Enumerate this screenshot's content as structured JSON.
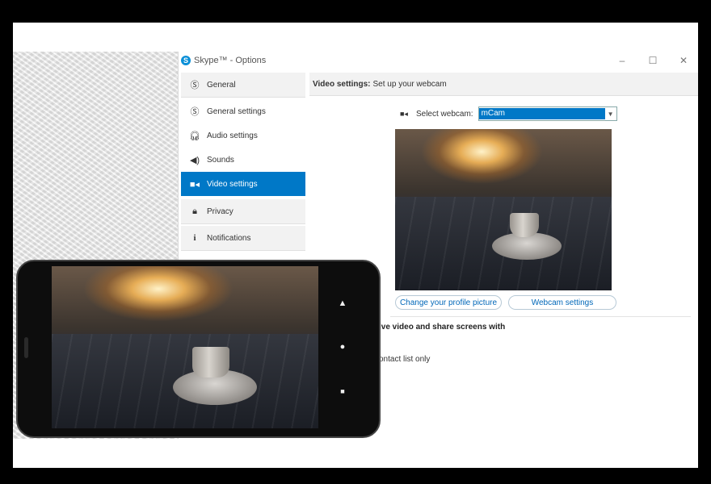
{
  "window": {
    "title": "Skype™ - Options",
    "logo": "S",
    "controls": {
      "minimize": "–",
      "maximize": "☐",
      "close": "✕"
    }
  },
  "sidebar": {
    "general": {
      "label": "General",
      "icon": "skype-icon"
    },
    "sub_items": [
      {
        "label": "General settings",
        "icon": "skype-icon",
        "active": false
      },
      {
        "label": "Audio settings",
        "icon": "headset-icon",
        "active": false
      },
      {
        "label": "Sounds",
        "icon": "speaker-icon",
        "active": false
      },
      {
        "label": "Video settings",
        "icon": "video-camera-icon",
        "active": true
      }
    ],
    "privacy": {
      "label": "Privacy",
      "icon": "lock-icon"
    },
    "notifications": {
      "label": "Notifications",
      "icon": "info-icon"
    }
  },
  "content": {
    "header_bold": "Video settings:",
    "header_text": "Set up your webcam",
    "webcam_label": "Select webcam:",
    "webcam_value": "mCam",
    "change_picture_button": "Change your profile picture",
    "webcam_settings_button": "Webcam settings",
    "share_text": "ive video and share screens with",
    "contacts_text": "ontact list only"
  },
  "phone": {
    "nav": {
      "back": "▲",
      "home": "●",
      "recents": "■"
    }
  },
  "colors": {
    "accent": "#0078c7",
    "skype_blue": "#0a8fd7"
  }
}
